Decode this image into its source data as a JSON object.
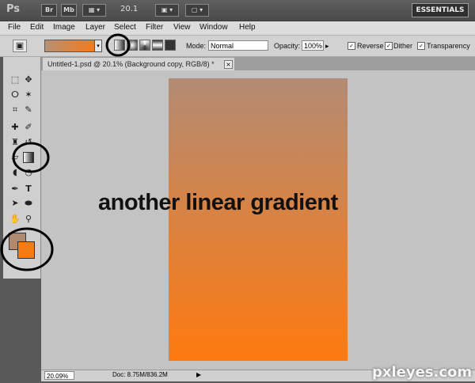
{
  "appbar": {
    "logo": "Ps",
    "bridge_btn": "Br",
    "mini_bridge_btn": "Mb",
    "zoom_value": "20.1",
    "workspace_label": "ESSENTIALS"
  },
  "menu": [
    "File",
    "Edit",
    "Image",
    "Layer",
    "Select",
    "Filter",
    "View",
    "Window",
    "Help"
  ],
  "options": {
    "mode_label": "Mode:",
    "mode_value": "Normal",
    "opacity_label": "Opacity:",
    "opacity_value": "100%",
    "reverse_label": "Reverse",
    "dither_label": "Dither",
    "transparency_label": "Transparency",
    "reverse_checked": true,
    "dither_checked": true,
    "transparency_checked": true
  },
  "document": {
    "tab_title": "Untitled-1.psd @ 20.1% (Background copy, RGB/8) *",
    "gradient_colors": [
      "#b38b74",
      "#ff7a10"
    ]
  },
  "annotation": {
    "text": "another linear gradient"
  },
  "swatches": {
    "foreground": "#b08a70",
    "background": "#f47a14"
  },
  "status": {
    "zoom": "20.09%",
    "doc_info": "Doc: 8.75M/836.2M"
  },
  "watermark": "pxleyes.com"
}
